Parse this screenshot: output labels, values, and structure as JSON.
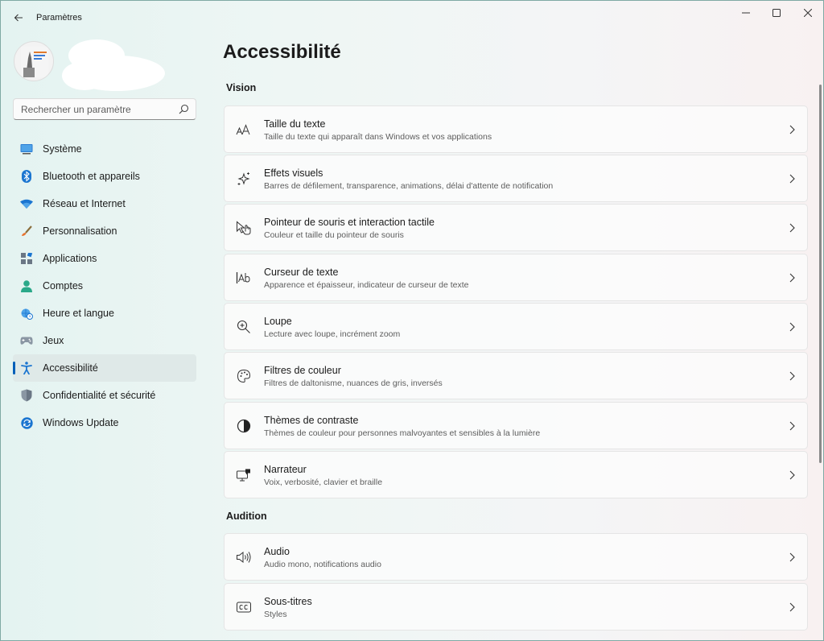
{
  "window": {
    "title": "Paramètres"
  },
  "search": {
    "placeholder": "Rechercher un paramètre"
  },
  "sidebar": {
    "items": [
      {
        "label": "Système",
        "icon": "monitor-icon"
      },
      {
        "label": "Bluetooth et appareils",
        "icon": "bluetooth-icon"
      },
      {
        "label": "Réseau et Internet",
        "icon": "wifi-icon"
      },
      {
        "label": "Personnalisation",
        "icon": "brush-icon"
      },
      {
        "label": "Applications",
        "icon": "apps-icon"
      },
      {
        "label": "Comptes",
        "icon": "person-icon"
      },
      {
        "label": "Heure et langue",
        "icon": "globe-clock-icon"
      },
      {
        "label": "Jeux",
        "icon": "gamepad-icon"
      },
      {
        "label": "Accessibilité",
        "icon": "accessibility-icon",
        "active": true
      },
      {
        "label": "Confidentialité et sécurité",
        "icon": "shield-icon"
      },
      {
        "label": "Windows Update",
        "icon": "update-icon"
      }
    ]
  },
  "main": {
    "title": "Accessibilité",
    "sections": [
      {
        "title": "Vision",
        "cards": [
          {
            "title": "Taille du texte",
            "subtitle": "Taille du texte qui apparaît dans Windows et vos applications",
            "icon": "text-size-icon"
          },
          {
            "title": "Effets visuels",
            "subtitle": "Barres de défilement, transparence, animations, délai d'attente de notification",
            "icon": "sparkle-icon"
          },
          {
            "title": "Pointeur de souris et interaction tactile",
            "subtitle": "Couleur et taille du pointeur de souris",
            "icon": "mouse-pointer-icon"
          },
          {
            "title": "Curseur de texte",
            "subtitle": "Apparence et épaisseur, indicateur de curseur de texte",
            "icon": "text-cursor-icon"
          },
          {
            "title": "Loupe",
            "subtitle": "Lecture avec loupe, incrément zoom",
            "icon": "magnifier-icon"
          },
          {
            "title": "Filtres de couleur",
            "subtitle": "Filtres de daltonisme, nuances de gris, inversés",
            "icon": "palette-icon"
          },
          {
            "title": "Thèmes de contraste",
            "subtitle": "Thèmes de couleur pour personnes malvoyantes et sensibles à la lumière",
            "icon": "contrast-icon"
          },
          {
            "title": "Narrateur",
            "subtitle": "Voix, verbosité, clavier et braille",
            "icon": "narrator-icon"
          }
        ]
      },
      {
        "title": "Audition",
        "cards": [
          {
            "title": "Audio",
            "subtitle": "Audio mono, notifications audio",
            "icon": "speaker-icon"
          },
          {
            "title": "Sous-titres",
            "subtitle": "Styles",
            "icon": "closed-captions-icon"
          }
        ]
      }
    ]
  },
  "colors": {
    "accent": "#005fb8",
    "active_bg": "#dfe9e8"
  }
}
